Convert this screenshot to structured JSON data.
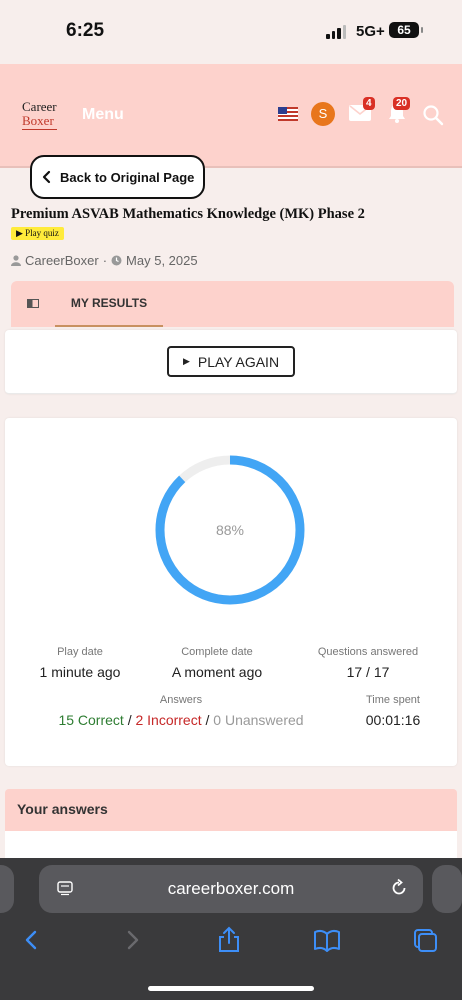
{
  "status_bar": {
    "time": "6:25",
    "network": "5G+",
    "battery": "65"
  },
  "header": {
    "logo_line1": "Career",
    "logo_line2": "Boxer",
    "menu_label": "Menu",
    "avatar_letter": "S",
    "mail_badge": "4",
    "notification_badge": "20"
  },
  "back_button": {
    "label": "Back to Original Page"
  },
  "quiz": {
    "title": "Premium ASVAB Mathematics Knowledge (MK) Phase 2",
    "tag": "Play quiz",
    "author": "CareerBoxer",
    "separator": "·",
    "date": "May 5, 2025"
  },
  "tabs": {
    "results_label": "MY RESULTS"
  },
  "play_again": {
    "label": "PLAY AGAIN"
  },
  "results": {
    "percent_label": "88%",
    "percent_value": 0.88,
    "play_date_label": "Play date",
    "play_date_value": "1 minute ago",
    "complete_date_label": "Complete date",
    "complete_date_value": "A moment ago",
    "questions_label": "Questions answered",
    "questions_value": "17 / 17",
    "answers_label": "Answers",
    "correct": "15 Correct",
    "sep": "/",
    "incorrect": "2 Incorrect",
    "unanswered": "0 Unanswered",
    "time_label": "Time spent",
    "time_value": "00:01:16"
  },
  "your_answers": {
    "heading": "Your answers"
  },
  "browser": {
    "url": "careerboxer.com"
  },
  "colors": {
    "header_bg": "#fdd2cc",
    "progress": "#42a5f5",
    "correct": "#2e7d32",
    "incorrect": "#c62828"
  }
}
